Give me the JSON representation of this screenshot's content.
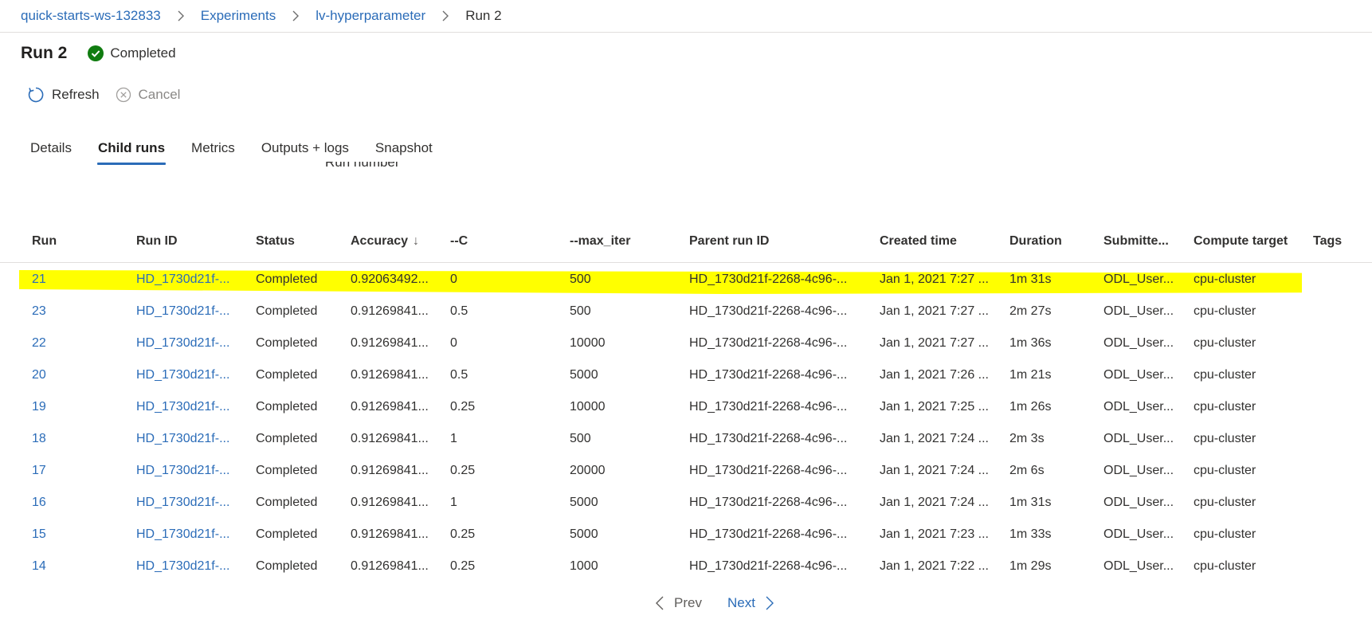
{
  "breadcrumb": {
    "items": [
      "quick-starts-ws-132833",
      "Experiments",
      "lv-hyperparameter"
    ],
    "current": "Run 2"
  },
  "header": {
    "title": "Run 2",
    "status": "Completed",
    "status_color": "#107c10"
  },
  "toolbar": {
    "refresh_label": "Refresh",
    "cancel_label": "Cancel"
  },
  "tabs": [
    {
      "label": "Details",
      "active": false
    },
    {
      "label": "Child runs",
      "active": true
    },
    {
      "label": "Metrics",
      "active": false
    },
    {
      "label": "Outputs + logs",
      "active": false
    },
    {
      "label": "Snapshot",
      "active": false
    }
  ],
  "clipped_label": "Run number",
  "table": {
    "columns": [
      "Run",
      "Run ID",
      "Status",
      "Accuracy",
      "--C",
      "--max_iter",
      "Parent run ID",
      "Created time",
      "Duration",
      "Submitte...",
      "Compute target",
      "Tags"
    ],
    "sort_column": "Accuracy",
    "sort_direction": "descending",
    "highlighted_row_index": 0,
    "highlight_color": "#ffff00",
    "rows": [
      {
        "run": "21",
        "run_id": "HD_1730d21f-...",
        "status": "Completed",
        "accuracy": "0.92063492...",
        "c": "0",
        "max_iter": "500",
        "parent_run_id": "HD_1730d21f-2268-4c96-...",
        "created_time": "Jan 1, 2021 7:27 ...",
        "duration": "1m 31s",
        "submitted_by": "ODL_User...",
        "compute_target": "cpu-cluster",
        "tags": ""
      },
      {
        "run": "23",
        "run_id": "HD_1730d21f-...",
        "status": "Completed",
        "accuracy": "0.91269841...",
        "c": "0.5",
        "max_iter": "500",
        "parent_run_id": "HD_1730d21f-2268-4c96-...",
        "created_time": "Jan 1, 2021 7:27 ...",
        "duration": "2m 27s",
        "submitted_by": "ODL_User...",
        "compute_target": "cpu-cluster",
        "tags": ""
      },
      {
        "run": "22",
        "run_id": "HD_1730d21f-...",
        "status": "Completed",
        "accuracy": "0.91269841...",
        "c": "0",
        "max_iter": "10000",
        "parent_run_id": "HD_1730d21f-2268-4c96-...",
        "created_time": "Jan 1, 2021 7:27 ...",
        "duration": "1m 36s",
        "submitted_by": "ODL_User...",
        "compute_target": "cpu-cluster",
        "tags": ""
      },
      {
        "run": "20",
        "run_id": "HD_1730d21f-...",
        "status": "Completed",
        "accuracy": "0.91269841...",
        "c": "0.5",
        "max_iter": "5000",
        "parent_run_id": "HD_1730d21f-2268-4c96-...",
        "created_time": "Jan 1, 2021 7:26 ...",
        "duration": "1m 21s",
        "submitted_by": "ODL_User...",
        "compute_target": "cpu-cluster",
        "tags": ""
      },
      {
        "run": "19",
        "run_id": "HD_1730d21f-...",
        "status": "Completed",
        "accuracy": "0.91269841...",
        "c": "0.25",
        "max_iter": "10000",
        "parent_run_id": "HD_1730d21f-2268-4c96-...",
        "created_time": "Jan 1, 2021 7:25 ...",
        "duration": "1m 26s",
        "submitted_by": "ODL_User...",
        "compute_target": "cpu-cluster",
        "tags": ""
      },
      {
        "run": "18",
        "run_id": "HD_1730d21f-...",
        "status": "Completed",
        "accuracy": "0.91269841...",
        "c": "1",
        "max_iter": "500",
        "parent_run_id": "HD_1730d21f-2268-4c96-...",
        "created_time": "Jan 1, 2021 7:24 ...",
        "duration": "2m 3s",
        "submitted_by": "ODL_User...",
        "compute_target": "cpu-cluster",
        "tags": ""
      },
      {
        "run": "17",
        "run_id": "HD_1730d21f-...",
        "status": "Completed",
        "accuracy": "0.91269841...",
        "c": "0.25",
        "max_iter": "20000",
        "parent_run_id": "HD_1730d21f-2268-4c96-...",
        "created_time": "Jan 1, 2021 7:24 ...",
        "duration": "2m 6s",
        "submitted_by": "ODL_User...",
        "compute_target": "cpu-cluster",
        "tags": ""
      },
      {
        "run": "16",
        "run_id": "HD_1730d21f-...",
        "status": "Completed",
        "accuracy": "0.91269841...",
        "c": "1",
        "max_iter": "5000",
        "parent_run_id": "HD_1730d21f-2268-4c96-...",
        "created_time": "Jan 1, 2021 7:24 ...",
        "duration": "1m 31s",
        "submitted_by": "ODL_User...",
        "compute_target": "cpu-cluster",
        "tags": ""
      },
      {
        "run": "15",
        "run_id": "HD_1730d21f-...",
        "status": "Completed",
        "accuracy": "0.91269841...",
        "c": "0.25",
        "max_iter": "5000",
        "parent_run_id": "HD_1730d21f-2268-4c96-...",
        "created_time": "Jan 1, 2021 7:23 ...",
        "duration": "1m 33s",
        "submitted_by": "ODL_User...",
        "compute_target": "cpu-cluster",
        "tags": ""
      },
      {
        "run": "14",
        "run_id": "HD_1730d21f-...",
        "status": "Completed",
        "accuracy": "0.91269841...",
        "c": "0.25",
        "max_iter": "1000",
        "parent_run_id": "HD_1730d21f-2268-4c96-...",
        "created_time": "Jan 1, 2021 7:22 ...",
        "duration": "1m 29s",
        "submitted_by": "ODL_User...",
        "compute_target": "cpu-cluster",
        "tags": ""
      }
    ]
  },
  "pager": {
    "prev_label": "Prev",
    "next_label": "Next"
  }
}
